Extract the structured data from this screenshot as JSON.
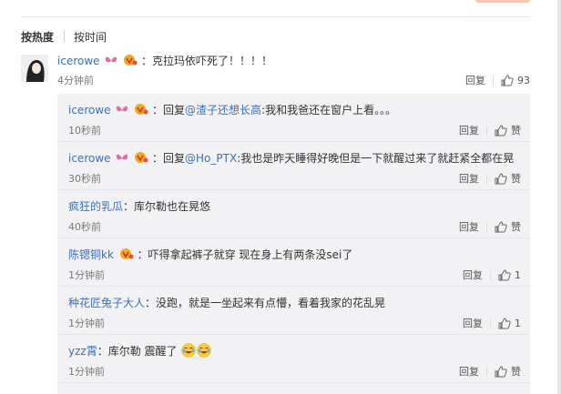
{
  "tabs": {
    "hot": "按热度",
    "time": "按时间"
  },
  "main": {
    "username": "icerowe",
    "text": "：克拉玛依吓死了！！！！",
    "time": "4分钟前",
    "reply_label": "回复",
    "like_count": "93"
  },
  "replies": [
    {
      "username": "icerowe",
      "badges": true,
      "prefix": "：回复",
      "mention": "@渣子还想长高",
      "text": ":我和我爸还在窗户上看。。。",
      "time": "10秒前",
      "reply_label": "回复",
      "like_label": "赞"
    },
    {
      "username": "icerowe",
      "badges": true,
      "prefix": "：回复",
      "mention": "@Ho_PTX",
      "text": ":我也是昨天睡得好晚但是一下就醒过来了就赶紧全都在晃",
      "time": "30秒前",
      "reply_label": "回复",
      "like_label": "赞"
    },
    {
      "username": "疯狂的乳瓜",
      "badges": false,
      "prefix": "",
      "mention": "",
      "text": "：库尔勒也在晃悠",
      "time": "40秒前",
      "reply_label": "回复",
      "like_label": "赞"
    },
    {
      "username": "陈锶铜kk",
      "badges": "vip",
      "prefix": "",
      "mention": "",
      "text": "：吓得拿起裤子就穿 现在身上有两条没sei了",
      "time": "1分钟前",
      "reply_label": "回复",
      "like_label": "1"
    },
    {
      "username": "种花匠兔子大人",
      "badges": false,
      "prefix": "",
      "mention": "",
      "text": "：没跑，就是一坐起来有点懵，看着我家的花乱晃",
      "time": "1分钟前",
      "reply_label": "回复",
      "like_label": "1"
    },
    {
      "username": "yzz霄",
      "badges": false,
      "prefix": "",
      "mention": "",
      "text": "：库尔勒 震醒了",
      "time": "1分钟前",
      "reply_label": "回复",
      "like_label": "赞",
      "emojis": [
        "laugh-cry-emoji",
        "laugh-cry-emoji"
      ]
    }
  ]
}
